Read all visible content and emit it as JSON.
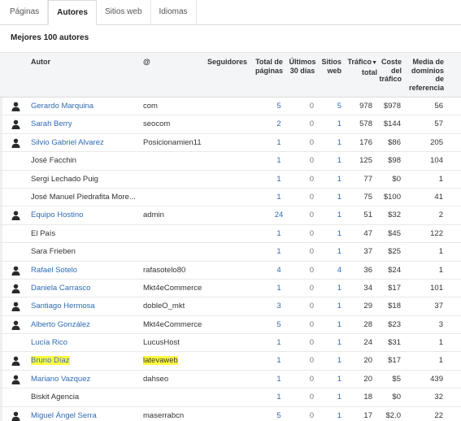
{
  "tabs": [
    {
      "label": "Páginas",
      "active": false
    },
    {
      "label": "Autores",
      "active": true
    },
    {
      "label": "Sitios web",
      "active": false
    },
    {
      "label": "Idiomas",
      "active": false
    }
  ],
  "section_title": "Mejores 100 autores",
  "columns": {
    "autor": "Autor",
    "at": "@",
    "seguidores": "Seguidores",
    "total_paginas": [
      "Total de",
      "páginas"
    ],
    "ultimos": [
      "Últimos",
      "30 días"
    ],
    "sitios": [
      "Sitios",
      "web"
    ],
    "trafico": [
      "Tráfico",
      "total"
    ],
    "coste": [
      "Coste",
      "del",
      "tráfico"
    ],
    "media": [
      "Media de",
      "dominios",
      "de",
      "referencia"
    ]
  },
  "colors": {
    "link": "#2f6bb5",
    "highlight": "#ffff3c"
  },
  "rows": [
    {
      "avatar": true,
      "autor": "Gerardo Marquina",
      "autor_link": true,
      "at": "com",
      "total": "5",
      "ultimos": "0",
      "sitios": "5",
      "trafico": "978",
      "coste": "$978",
      "media": "56"
    },
    {
      "avatar": true,
      "autor": "Sarah Berry",
      "autor_link": true,
      "at": "seocom",
      "total": "2",
      "ultimos": "0",
      "sitios": "1",
      "trafico": "578",
      "coste": "$144",
      "media": "57"
    },
    {
      "avatar": true,
      "autor": "Silvio Gabriel Alvarez",
      "autor_link": true,
      "at": "Posicionamien11",
      "total": "1",
      "ultimos": "0",
      "sitios": "1",
      "trafico": "176",
      "coste": "$86",
      "media": "205"
    },
    {
      "avatar": false,
      "autor": "José Facchin",
      "autor_link": false,
      "at": "",
      "total": "1",
      "ultimos": "0",
      "sitios": "1",
      "trafico": "125",
      "coste": "$98",
      "media": "104"
    },
    {
      "avatar": false,
      "autor": "Sergi Lechado Puig",
      "autor_link": false,
      "at": "",
      "total": "1",
      "ultimos": "0",
      "sitios": "1",
      "trafico": "77",
      "coste": "$0",
      "media": "1"
    },
    {
      "avatar": false,
      "autor": "José Manuel Piedrafita More...",
      "autor_link": false,
      "at": "",
      "total": "1",
      "ultimos": "0",
      "sitios": "1",
      "trafico": "75",
      "coste": "$100",
      "media": "41"
    },
    {
      "avatar": true,
      "autor": "Equipo Hostino",
      "autor_link": true,
      "at": "admin",
      "total": "24",
      "ultimos": "0",
      "sitios": "1",
      "trafico": "51",
      "coste": "$32",
      "media": "2"
    },
    {
      "avatar": false,
      "autor": "El País",
      "autor_link": false,
      "at": "",
      "total": "1",
      "ultimos": "0",
      "sitios": "1",
      "trafico": "47",
      "coste": "$45",
      "media": "122"
    },
    {
      "avatar": false,
      "autor": "Sara Frieben",
      "autor_link": false,
      "at": "",
      "total": "1",
      "ultimos": "0",
      "sitios": "1",
      "trafico": "37",
      "coste": "$25",
      "media": "1"
    },
    {
      "avatar": true,
      "autor": "Rafael Sotelo",
      "autor_link": true,
      "at": "rafasotelo80",
      "total": "4",
      "ultimos": "0",
      "sitios": "4",
      "trafico": "36",
      "coste": "$24",
      "media": "1"
    },
    {
      "avatar": true,
      "autor": "Daniela Carrasco",
      "autor_link": true,
      "at": "Mkt4eCommerce",
      "total": "1",
      "ultimos": "0",
      "sitios": "1",
      "trafico": "34",
      "coste": "$17",
      "media": "101"
    },
    {
      "avatar": true,
      "autor": "Santiago Hermosa",
      "autor_link": true,
      "at": "dobleO_mkt",
      "total": "3",
      "ultimos": "0",
      "sitios": "1",
      "trafico": "29",
      "coste": "$18",
      "media": "37"
    },
    {
      "avatar": true,
      "autor": "Alberto González",
      "autor_link": true,
      "at": "Mkt4eCommerce",
      "total": "5",
      "ultimos": "0",
      "sitios": "1",
      "trafico": "28",
      "coste": "$23",
      "media": "3"
    },
    {
      "avatar": false,
      "autor": "Lucía Rico",
      "autor_link": true,
      "at": "LucusHost",
      "total": "1",
      "ultimos": "0",
      "sitios": "1",
      "trafico": "24",
      "coste": "$31",
      "media": "1"
    },
    {
      "avatar": true,
      "autor": "Bruno Díaz",
      "autor_link": true,
      "at": "latevaweb",
      "total": "1",
      "ultimos": "0",
      "sitios": "1",
      "trafico": "20",
      "coste": "$17",
      "media": "1",
      "highlight": true
    },
    {
      "avatar": true,
      "autor": "Mariano Vazquez",
      "autor_link": true,
      "at": "dahseo",
      "total": "1",
      "ultimos": "0",
      "sitios": "1",
      "trafico": "20",
      "coste": "$5",
      "media": "439"
    },
    {
      "avatar": false,
      "autor": "Biskit Agencia",
      "autor_link": false,
      "at": "",
      "total": "1",
      "ultimos": "0",
      "sitios": "1",
      "trafico": "18",
      "coste": "$0",
      "media": "32"
    },
    {
      "avatar": true,
      "autor": "Miguel Ángel Serra",
      "autor_link": true,
      "at": "maserrabcn",
      "total": "5",
      "ultimos": "0",
      "sitios": "1",
      "trafico": "17",
      "coste": "$2.0",
      "media": "22"
    }
  ]
}
